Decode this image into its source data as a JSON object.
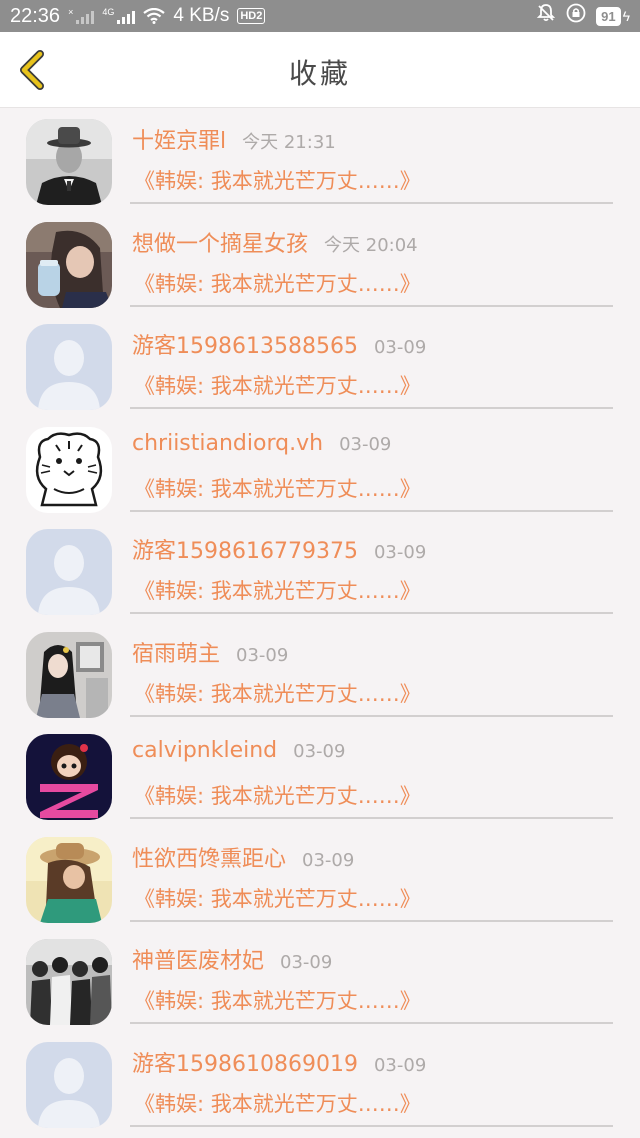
{
  "status_bar": {
    "time": "22:36",
    "net_speed": "4 KB/s",
    "hd_badge": "HD2",
    "battery": "91",
    "sim1_tag": "×",
    "sim2_tag": "4G"
  },
  "header": {
    "title": "收藏",
    "back_icon": "chevron-left-icon",
    "accent_color": "#e8c31c"
  },
  "favorites": [
    {
      "nickname": "十姪京罪l",
      "time": "今天 21:31",
      "article": "《韩娱: 我本就光芒万丈……》",
      "avatar": "photo-man-hat"
    },
    {
      "nickname": "想做一个摘星女孩",
      "time": "今天 20:04",
      "article": "《韩娱: 我本就光芒万丈……》",
      "avatar": "photo-girl-drink"
    },
    {
      "nickname": "游客1598613588565",
      "time": "03-09",
      "article": "《韩娱: 我本就光芒万丈……》",
      "avatar": "default-avatar"
    },
    {
      "nickname": "chriistiandiorq.vh",
      "time": "03-09",
      "article": "《韩娱: 我本就光芒万丈……》",
      "avatar": "tiger-sketch"
    },
    {
      "nickname": "游客1598616779375",
      "time": "03-09",
      "article": "《韩娱: 我本就光芒万丈……》",
      "avatar": "default-avatar"
    },
    {
      "nickname": "宿雨萌主",
      "time": "03-09",
      "article": "《韩娱: 我本就光芒万丈……》",
      "avatar": "photo-girl-room"
    },
    {
      "nickname": "calvipnkleind",
      "time": "03-09",
      "article": "《韩娱: 我本就光芒万丈……》",
      "avatar": "cartoon-girl-z"
    },
    {
      "nickname": "性欲西馋熏距心",
      "time": "03-09",
      "article": "《韩娱: 我本就光芒万丈……》",
      "avatar": "photo-hat-girl"
    },
    {
      "nickname": "神普医废材妃",
      "time": "03-09",
      "article": "《韩娱: 我本就光芒万丈……》",
      "avatar": "photo-group"
    },
    {
      "nickname": "游客1598610869019",
      "time": "03-09",
      "article": "《韩娱: 我本就光芒万丈……》",
      "avatar": "default-avatar"
    }
  ],
  "colors": {
    "text_accent": "#ef8d58",
    "time_gray": "#aeaaa9",
    "divider": "#d2cfcf",
    "list_bg": "#f6f3f4"
  }
}
